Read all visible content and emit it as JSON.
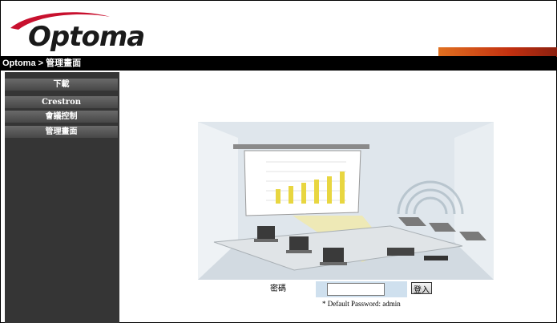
{
  "header": {
    "logo_text": "Optoma",
    "accent": "#c8102e"
  },
  "nav": {
    "breadcrumb": "Optoma > 管理畫面"
  },
  "sidebar": {
    "items": [
      {
        "label": "下載"
      },
      {
        "label": "Crestron"
      },
      {
        "label": "會議控制"
      },
      {
        "label": "管理畫面"
      }
    ]
  },
  "illustration": {
    "subject": "conference room with projector screen, bar chart and wireless laptops"
  },
  "login": {
    "password_label": "密碼",
    "password_value": "",
    "login_button": "登入",
    "hint": "* Default Password: admin"
  }
}
